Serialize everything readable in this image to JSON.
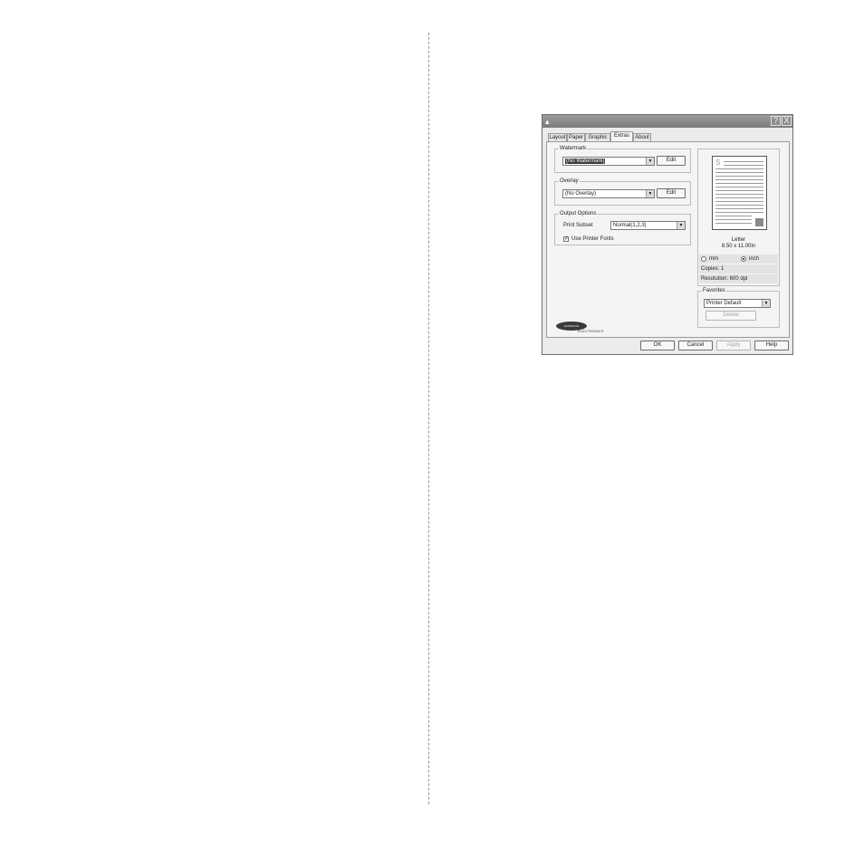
{
  "dialog": {
    "title_icon": "printer-icon",
    "help_btn": "?",
    "close_btn": "X"
  },
  "tabs": [
    "Layout",
    "Paper",
    "Graphic",
    "Extras",
    "About"
  ],
  "active_tab": "Extras",
  "watermark": {
    "label": "Watermark",
    "value": "(No Watermark)",
    "edit": "Edit"
  },
  "overlay": {
    "label": "Overlay",
    "value": "(No Overlay)",
    "edit": "Edit"
  },
  "output": {
    "label": "Output Options",
    "print_subset_label": "Print Subset",
    "print_subset_value": "Normal(1,2,3)",
    "use_printer_fonts": "Use Printer Fonts",
    "use_printer_fonts_checked": true
  },
  "preview": {
    "paper_name": "Letter",
    "paper_size": "8.50 x 11.00in",
    "unit_mm": "mm",
    "unit_inch": "inch",
    "selected_unit": "inch",
    "copies": "Copies: 1",
    "resolution": "Resolution: 600 dpi"
  },
  "favorites": {
    "label": "Favorites",
    "value": "Printer Default",
    "delete": "Delete"
  },
  "logo": {
    "brand": "SAMSUNG",
    "sub": "ELECTRONICS"
  },
  "buttons": {
    "ok": "OK",
    "cancel": "Cancel",
    "apply": "Apply",
    "help": "Help"
  }
}
